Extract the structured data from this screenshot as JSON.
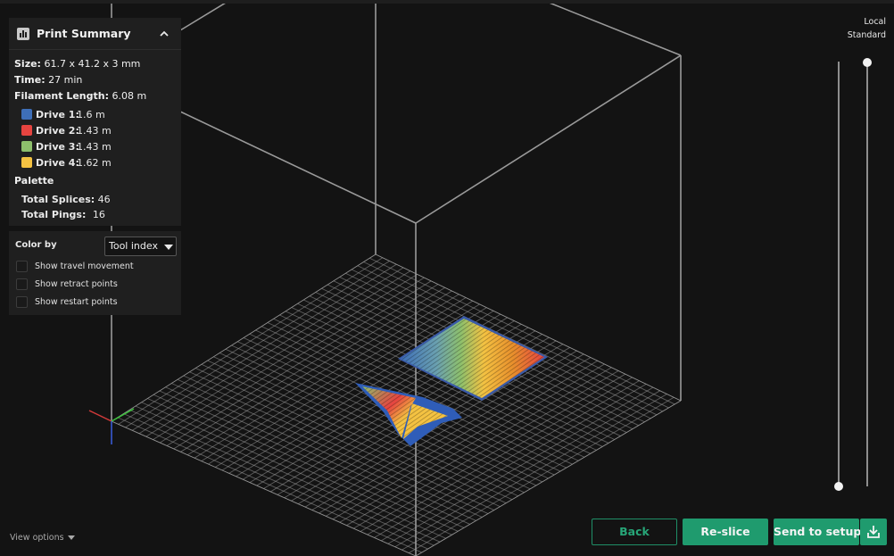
{
  "summary": {
    "title": "Print Summary",
    "size_label": "Size:",
    "size_value": "61.7 x 41.2 x 3 mm",
    "time_label": "Time:",
    "time_value": "27 min",
    "filament_label": "Filament Length:",
    "filament_value": "6.08 m",
    "drives": [
      {
        "label": "Drive 1:",
        "value": "1.6 m",
        "color": "#3e6fb8"
      },
      {
        "label": "Drive 2:",
        "value": "1.43 m",
        "color": "#e64440"
      },
      {
        "label": "Drive 3:",
        "value": "1.43 m",
        "color": "#8ec06c"
      },
      {
        "label": "Drive 4:",
        "value": "1.62 m",
        "color": "#f4c242"
      }
    ],
    "palette_label": "Palette",
    "splices_label": "Total Splices:",
    "splices_value": "46",
    "pings_label": "Total Pings:",
    "pings_value": "16"
  },
  "color_by": {
    "label": "Color by",
    "selected": "Tool index",
    "options": [
      {
        "label": "Show travel movement",
        "checked": false
      },
      {
        "label": "Show retract points",
        "checked": false
      },
      {
        "label": "Show restart points",
        "checked": false
      }
    ]
  },
  "slider": {
    "top_label": "Local",
    "sub_label": "Standard"
  },
  "view_options": "View options",
  "buttons": {
    "back": "Back",
    "reslice": "Re-slice",
    "send": "Send to setup"
  },
  "icons": {
    "summary": "bar-chart-icon",
    "collapse": "chevron-up-icon",
    "download": "download-icon"
  },
  "colors": {
    "accent": "#1f9b6e",
    "background": "#131313",
    "panel": "#1f1f1f"
  }
}
